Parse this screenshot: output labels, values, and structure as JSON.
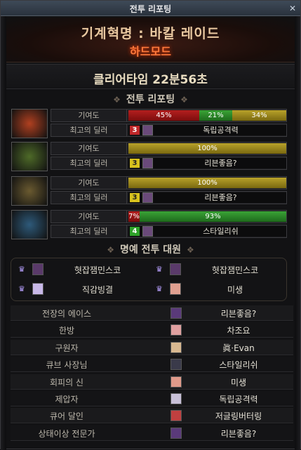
{
  "window": {
    "title": "전투 리포팅",
    "close_label": "✕"
  },
  "raid": {
    "title": "기계혁명 : 바칼 레이드",
    "mode": "하드모드"
  },
  "clear": {
    "text": "클리어타임  22분56초"
  },
  "section_report": {
    "title": "전투 리포팅",
    "deco_left": "❖",
    "deco_right": "❖"
  },
  "players": [
    {
      "contribution_label": "기여도",
      "dealer_label": "최고의 딜러",
      "bars": [
        {
          "label": "45%",
          "value": 45,
          "color": "red"
        },
        {
          "label": "21%",
          "value": 21,
          "color": "green"
        },
        {
          "label": "34%",
          "value": 34,
          "color": "gold"
        }
      ],
      "rank": "3",
      "rank_color": "red",
      "dealer": "독립공격력",
      "portrait_color": "#b04020"
    },
    {
      "contribution_label": "기여도",
      "dealer_label": "최고의 딜러",
      "bars": [
        {
          "label": "100%",
          "value": 100,
          "color": "gold"
        }
      ],
      "rank": "3",
      "rank_color": "yellow",
      "dealer": "리븐좋음?",
      "portrait_color": "#4e6a28"
    },
    {
      "contribution_label": "기여도",
      "dealer_label": "최고의 딜러",
      "bars": [
        {
          "label": "100%",
          "value": 100,
          "color": "gold"
        }
      ],
      "rank": "3",
      "rank_color": "yellow",
      "dealer": "리븐좋음?",
      "portrait_color": "#6a5a30"
    },
    {
      "contribution_label": "기여도",
      "dealer_label": "최고의 딜러",
      "bars": [
        {
          "label": "7%",
          "value": 7,
          "color": "red"
        },
        {
          "label": "93%",
          "value": 93,
          "color": "green"
        }
      ],
      "rank": "4",
      "rank_color": "green",
      "dealer": "스타일리쉬",
      "portrait_color": "#2e5a7a"
    }
  ],
  "section_honor": {
    "title": "명예 전투 대원",
    "deco_left": "❖",
    "deco_right": "❖"
  },
  "honor": [
    {
      "name": "혓잡잼민스코",
      "icon": "crown-icon"
    },
    {
      "name": "혓잡잼민스코",
      "icon": "crown-icon"
    },
    {
      "name": "직감빙결",
      "icon": "crown-icon"
    },
    {
      "name": "미생",
      "icon": "crown-icon"
    }
  ],
  "awards": [
    {
      "label": "전장의 에이스",
      "name": "리븐좋음?"
    },
    {
      "label": "한방",
      "name": "차조요"
    },
    {
      "label": "구원자",
      "name": "眞·Evan"
    },
    {
      "label": "큐브 사장님",
      "name": "스타일리쉬"
    },
    {
      "label": "회피의 신",
      "name": "미생"
    },
    {
      "label": "제압자",
      "name": "독립공격력"
    },
    {
      "label": "큐어 달인",
      "name": "저글링버터링"
    },
    {
      "label": "상태이상 전문가",
      "name": "리븐좋음?"
    }
  ]
}
